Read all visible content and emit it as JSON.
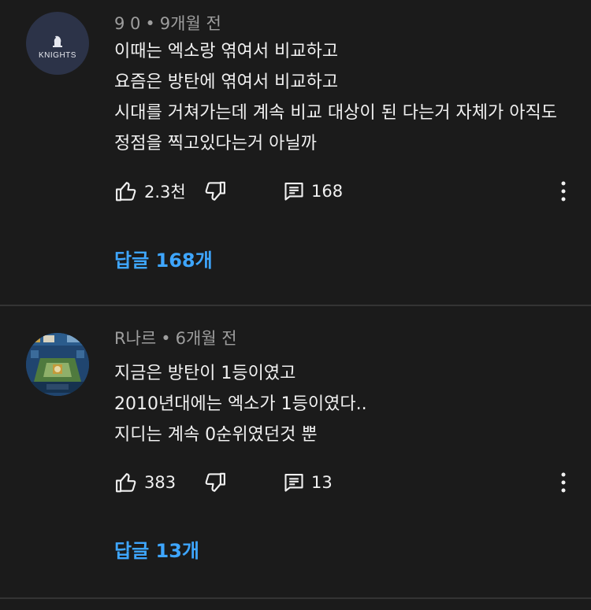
{
  "comments": [
    {
      "author": "9 0",
      "separator": "•",
      "time": "9개월 전",
      "avatar_text": "KNIGHTS",
      "lines": [
        "이때는 엑소랑 엮여서 비교하고",
        "요즘은 방탄에 엮여서 비교하고",
        "시대를 거쳐가는데 계속 비교 대상이 된 다는거 자체가 아직도",
        "정점을 찍고있다는거 아닐까"
      ],
      "likes": "2.3천",
      "reply_count": "168",
      "replies_label": "답글 168개"
    },
    {
      "author": "R나르",
      "separator": "•",
      "time": "6개월 전",
      "lines": [
        "지금은 방탄이 1등이였고",
        "2010년대에는 엑소가 1등이였다..",
        "지디는 계속 0순위였던것 뿐"
      ],
      "likes": "383",
      "reply_count": "13",
      "replies_label": "답글 13개"
    }
  ],
  "icons": {
    "like": "thumbs-up-icon",
    "dislike": "thumbs-down-icon",
    "reply": "comment-icon",
    "more": "more-vertical-icon"
  },
  "colors": {
    "background": "#1b1b1b",
    "text": "#f1f1f1",
    "meta": "#9e9e9e",
    "link": "#3ea6ff"
  }
}
